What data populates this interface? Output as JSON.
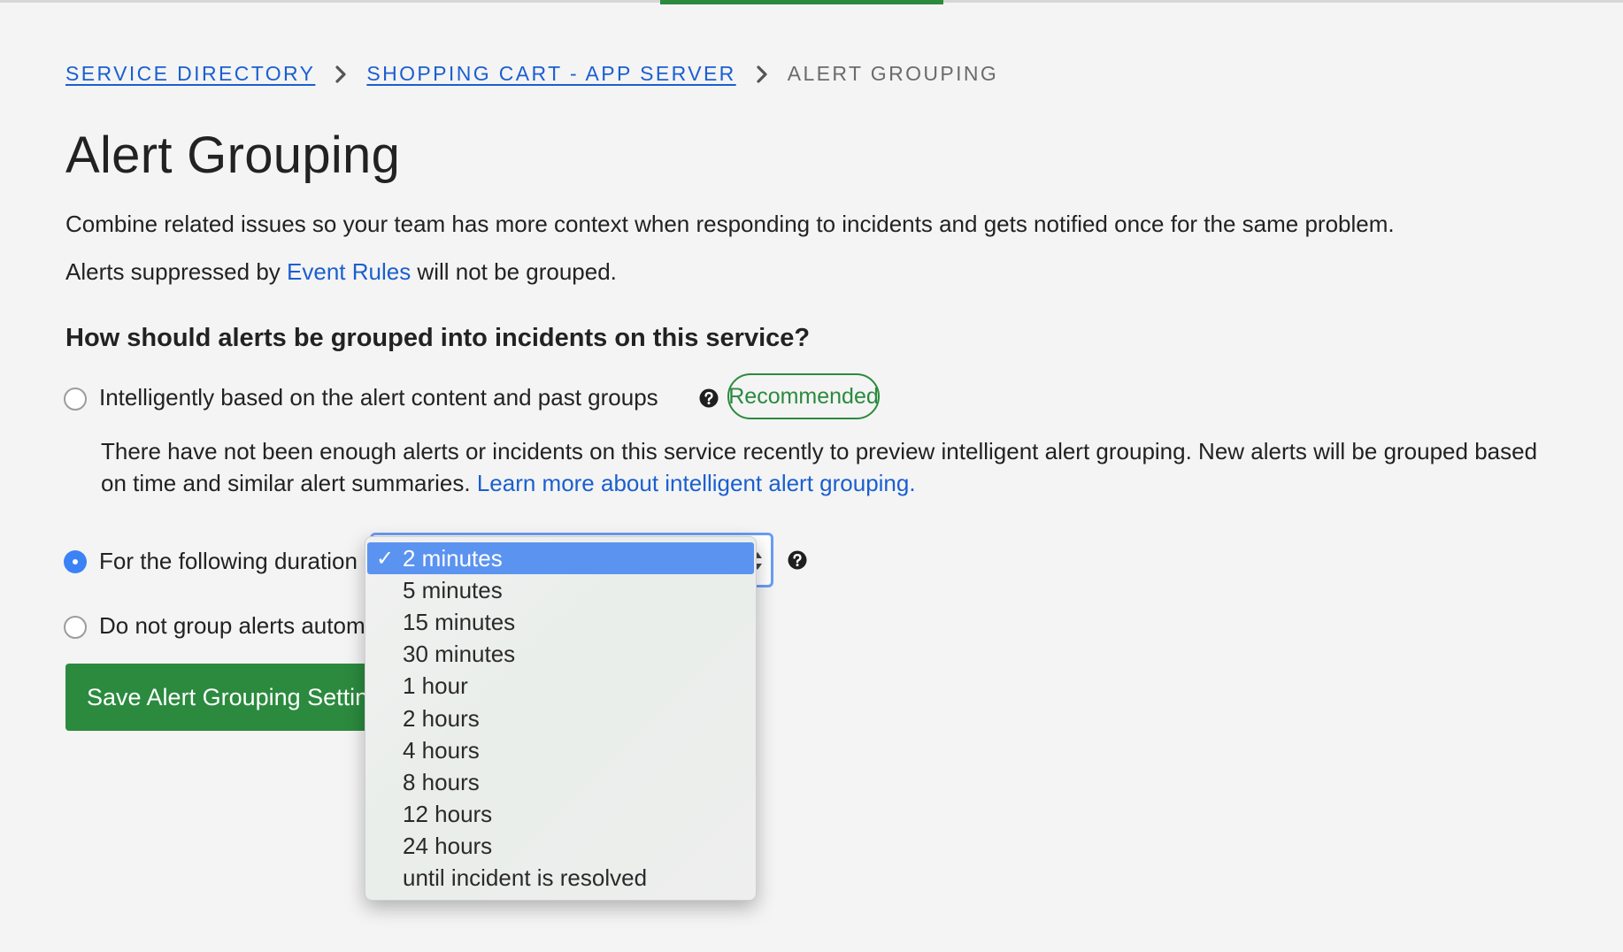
{
  "breadcrumb": {
    "items": [
      {
        "label": "SERVICE DIRECTORY"
      },
      {
        "label": "SHOPPING CART - APP SERVER"
      }
    ],
    "current": "ALERT GROUPING"
  },
  "page": {
    "title": "Alert Grouping",
    "description": "Combine related issues so your team has more context when responding to incidents and gets notified once for the same problem.",
    "suppressed_prefix": "Alerts suppressed by ",
    "event_rules_link": "Event Rules",
    "suppressed_suffix": " will not be grouped."
  },
  "question": "How should alerts be grouped into incidents on this service?",
  "options": {
    "intelligent": {
      "label": "Intelligently based on the alert content and past groups",
      "badge": "Recommended",
      "note": "There have not been enough alerts or incidents on this service recently to preview intelligent alert grouping. New alerts will be grouped based on time and similar alert summaries. ",
      "learn_more": "Learn more about intelligent alert grouping.",
      "checked": false
    },
    "duration": {
      "label": "For the following duration",
      "checked": true
    },
    "none": {
      "label": "Do not group alerts autom",
      "checked": false
    }
  },
  "save_button": "Save Alert Grouping Settings",
  "dropdown": {
    "check_mark": "✓",
    "selected": "2 minutes",
    "options": [
      "2 minutes",
      "5 minutes",
      "15 minutes",
      "30 minutes",
      "1 hour",
      "2 hours",
      "4 hours",
      "8 hours",
      "12 hours",
      "24 hours",
      "until incident is resolved"
    ]
  },
  "colors": {
    "accent_green": "#2b8a3e",
    "link_blue": "#1a5fd0",
    "selection_blue": "#5b93f0",
    "radio_blue": "#3b82f6"
  },
  "icons": {
    "breadcrumb_separator": "chevron-right-icon",
    "help": "question-circle-icon",
    "select_arrows": "up-down-arrows-icon"
  }
}
